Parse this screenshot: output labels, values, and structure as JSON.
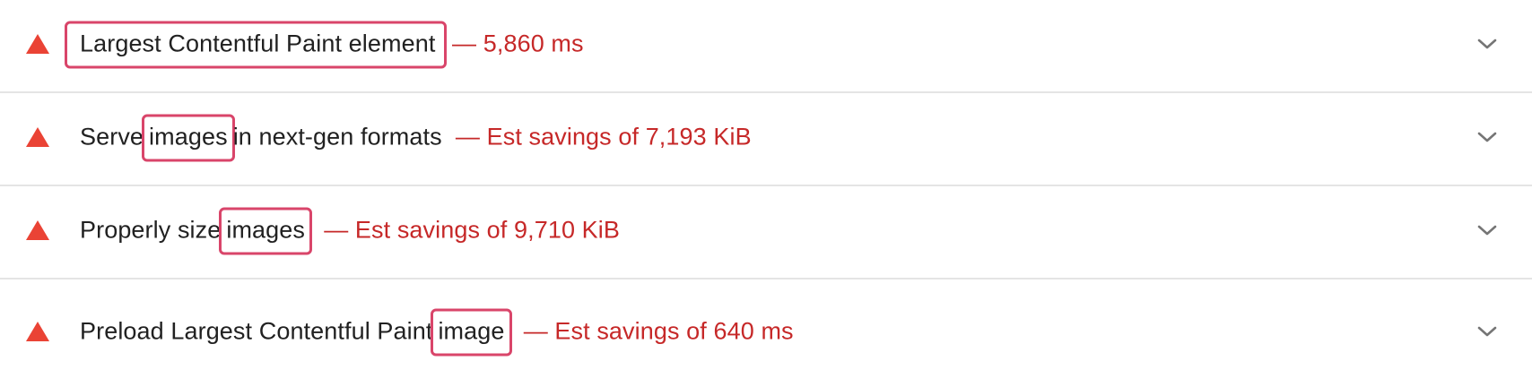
{
  "accent": {
    "fail": "#ea4335",
    "detail": "#c62828",
    "highlight": "#d9456a"
  },
  "audits": [
    {
      "icon": "fail-triangle-icon",
      "pre": "",
      "highlight": "Largest Contentful Paint element",
      "post": "",
      "detail": " — 5,860 ms",
      "expand_icon": "chevron-down-icon"
    },
    {
      "icon": "fail-triangle-icon",
      "pre": "Serve",
      "highlight": "images",
      "post": "in next-gen formats ",
      "detail": " — Est savings of 7,193 KiB",
      "expand_icon": "chevron-down-icon"
    },
    {
      "icon": "fail-triangle-icon",
      "pre": "Properly size",
      "highlight": "images",
      "post": " ",
      "detail": " — Est savings of 9,710 KiB",
      "expand_icon": "chevron-down-icon"
    },
    {
      "icon": "fail-triangle-icon",
      "pre": "Preload Largest Contentful Paint",
      "highlight": "image",
      "post": " ",
      "detail": " — Est savings of 640 ms",
      "expand_icon": "chevron-down-icon"
    }
  ]
}
